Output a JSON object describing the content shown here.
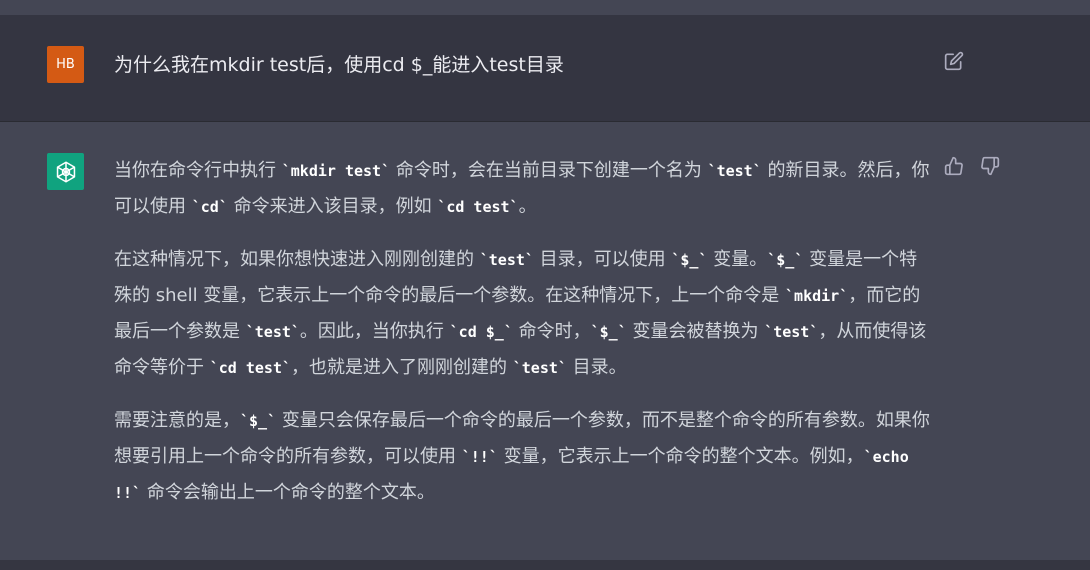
{
  "user_message": {
    "avatar_initials": "HB",
    "text": "为什么我在mkdir test后，使用cd $_能进入test目录"
  },
  "assistant_message": {
    "paragraphs": [
      [
        {
          "t": "当你在命令行中执行 "
        },
        {
          "c": "`mkdir test`"
        },
        {
          "t": " 命令时，会在当前目录下创建一个名为 "
        },
        {
          "c": "`test`"
        },
        {
          "t": " 的新目录。然后，你可以使用 "
        },
        {
          "c": "`cd`"
        },
        {
          "t": " 命令来进入该目录，例如 "
        },
        {
          "c": "`cd test`"
        },
        {
          "t": "。"
        }
      ],
      [
        {
          "t": "在这种情况下，如果你想快速进入刚刚创建的 "
        },
        {
          "c": "`test`"
        },
        {
          "t": " 目录，可以使用 "
        },
        {
          "c": "`$_`"
        },
        {
          "t": " 变量。"
        },
        {
          "c": "`$_`"
        },
        {
          "t": " 变量是一个特殊的 shell 变量，它表示上一个命令的最后一个参数。在这种情况下，上一个命令是 "
        },
        {
          "c": "`mkdir`"
        },
        {
          "t": "，而它的最后一个参数是 "
        },
        {
          "c": "`test`"
        },
        {
          "t": "。因此，当你执行 "
        },
        {
          "c": "`cd $_`"
        },
        {
          "t": " 命令时，"
        },
        {
          "c": "`$_`"
        },
        {
          "t": " 变量会被替换为 "
        },
        {
          "c": "`test`"
        },
        {
          "t": "，从而使得该命令等价于 "
        },
        {
          "c": "`cd test`"
        },
        {
          "t": "，也就是进入了刚刚创建的 "
        },
        {
          "c": "`test`"
        },
        {
          "t": " 目录。"
        }
      ],
      [
        {
          "t": "需要注意的是，"
        },
        {
          "c": "`$_`"
        },
        {
          "t": " 变量只会保存最后一个命令的最后一个参数，而不是整个命令的所有参数。如果你想要引用上一个命令的所有参数，可以使用 "
        },
        {
          "c": "`!!`"
        },
        {
          "t": " 变量，它表示上一个命令的整个文本。例如，"
        },
        {
          "c": "`echo !!`"
        },
        {
          "t": " 命令会输出上一个命令的整个文本。"
        }
      ]
    ]
  },
  "icons": {
    "edit": "edit-icon",
    "thumbs_up": "thumbs-up-icon",
    "thumbs_down": "thumbs-down-icon",
    "bot_logo": "openai-logo-icon"
  },
  "colors": {
    "user_bg": "#343541",
    "assistant_bg": "#444654",
    "user_avatar": "#d45a14",
    "bot_avatar": "#10a37f"
  }
}
